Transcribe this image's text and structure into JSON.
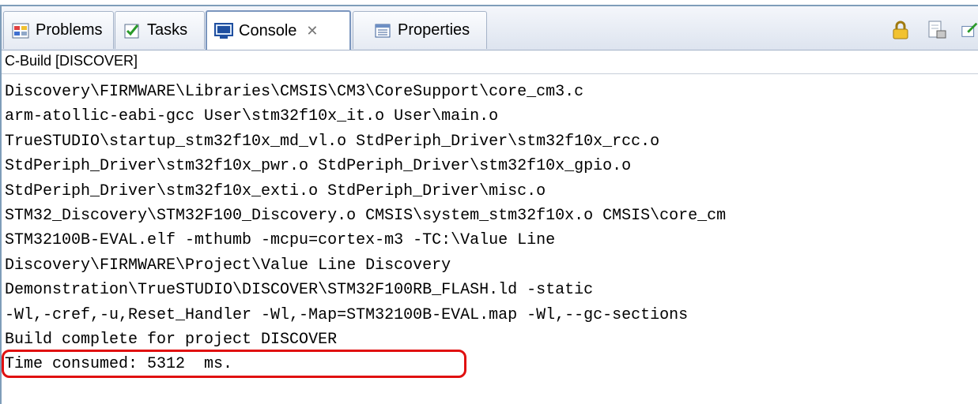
{
  "tabs": [
    {
      "label": "Problems",
      "icon": "problems-icon",
      "active": false
    },
    {
      "label": "Tasks",
      "icon": "tasks-icon",
      "active": false
    },
    {
      "label": "Console",
      "icon": "console-icon",
      "active": true,
      "close": "✕"
    },
    {
      "label": "Properties",
      "icon": "properties-icon",
      "active": false
    }
  ],
  "toolbar": {
    "icons": [
      "lock-icon",
      "clear-console-icon",
      "pin-icon"
    ]
  },
  "console": {
    "title": "C-Build [DISCOVER]",
    "lines": [
      "Discovery\\FIRMWARE\\Libraries\\CMSIS\\CM3\\CoreSupport\\core_cm3.c",
      "arm-atollic-eabi-gcc User\\stm32f10x_it.o User\\main.o",
      "TrueSTUDIO\\startup_stm32f10x_md_vl.o StdPeriph_Driver\\stm32f10x_rcc.o",
      "StdPeriph_Driver\\stm32f10x_pwr.o StdPeriph_Driver\\stm32f10x_gpio.o",
      "StdPeriph_Driver\\stm32f10x_exti.o StdPeriph_Driver\\misc.o",
      "STM32_Discovery\\STM32F100_Discovery.o CMSIS\\system_stm32f10x.o CMSIS\\core_cm",
      "STM32100B-EVAL.elf -mthumb -mcpu=cortex-m3 -TC:\\Value Line",
      "Discovery\\FIRMWARE\\Project\\Value Line Discovery",
      "Demonstration\\TrueSTUDIO\\DISCOVER\\STM32F100RB_FLASH.ld -static",
      "-Wl,-cref,-u,Reset_Handler -Wl,-Map=STM32100B-EVAL.map -Wl,--gc-sections",
      "Build complete for project DISCOVER",
      "Time consumed: 5312  ms."
    ]
  },
  "highlight_color": "#e01010"
}
